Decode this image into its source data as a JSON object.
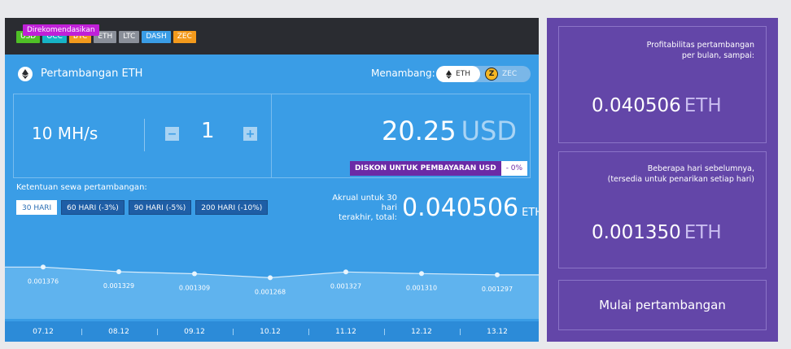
{
  "recommended_badge": "Direkomendasikan",
  "currency_tabs": [
    {
      "label": "USD",
      "color": "#4fc026"
    },
    {
      "label": "OCC",
      "color": "#16b4c6"
    },
    {
      "label": "BTC",
      "color": "#f39a1c"
    },
    {
      "label": "ETH",
      "color": "#8a8f99"
    },
    {
      "label": "LTC",
      "color": "#8a8f99"
    },
    {
      "label": "DASH",
      "color": "#3a9de6"
    },
    {
      "label": "ZEC",
      "color": "#f39a1c"
    }
  ],
  "header": {
    "title": "Pertambangan ETH",
    "mining_label": "Menambang:",
    "coin_eth": "ETH",
    "coin_zec": "ZEC"
  },
  "calculator": {
    "hashrate": "10 MH/s",
    "minus": "−",
    "quantity": "1",
    "plus": "+",
    "price_value": "20.25",
    "price_currency": "USD"
  },
  "discount": {
    "label_prefix": "DISKON UNTUK PEMBAYARAN",
    "label_currency": "USD",
    "value": "- 0%"
  },
  "terms": {
    "label": "Ketentuan sewa pertambangan:",
    "options": [
      "30 HARI",
      "60 HARI (-3%)",
      "90 HARI (-5%)",
      "200 HARI (-10%)"
    ],
    "active_index": 0
  },
  "accrual": {
    "label_line1": "Akrual untuk 30 hari",
    "label_line2": "terakhir, total:",
    "value": "0.040506",
    "unit": "ETH"
  },
  "chart_data": {
    "type": "area",
    "categories": [
      "07.12",
      "08.12",
      "09.12",
      "10.12",
      "11.12",
      "12.12",
      "13.12"
    ],
    "values": [
      0.001376,
      0.001329,
      0.001309,
      0.001268,
      0.001327,
      0.00131,
      0.001297
    ],
    "labels": [
      "0.001376",
      "0.001329",
      "0.001309",
      "0.001268",
      "0.001327",
      "0.001310",
      "0.001297"
    ],
    "ylim": [
      0.001,
      0.0014
    ]
  },
  "profit_panel": {
    "monthly_label_line1": "Profitabilitas pertambangan",
    "monthly_label_line2": "per bulan, sampai:",
    "monthly_value": "0.040506",
    "monthly_unit": "ETH",
    "prev_label_line1": "Beberapa hari sebelumnya,",
    "prev_label_line2": "(tersedia untuk penarikan setiap hari)",
    "prev_value": "0.001350",
    "prev_unit": "ETH",
    "start_button": "Mulai pertambangan"
  }
}
